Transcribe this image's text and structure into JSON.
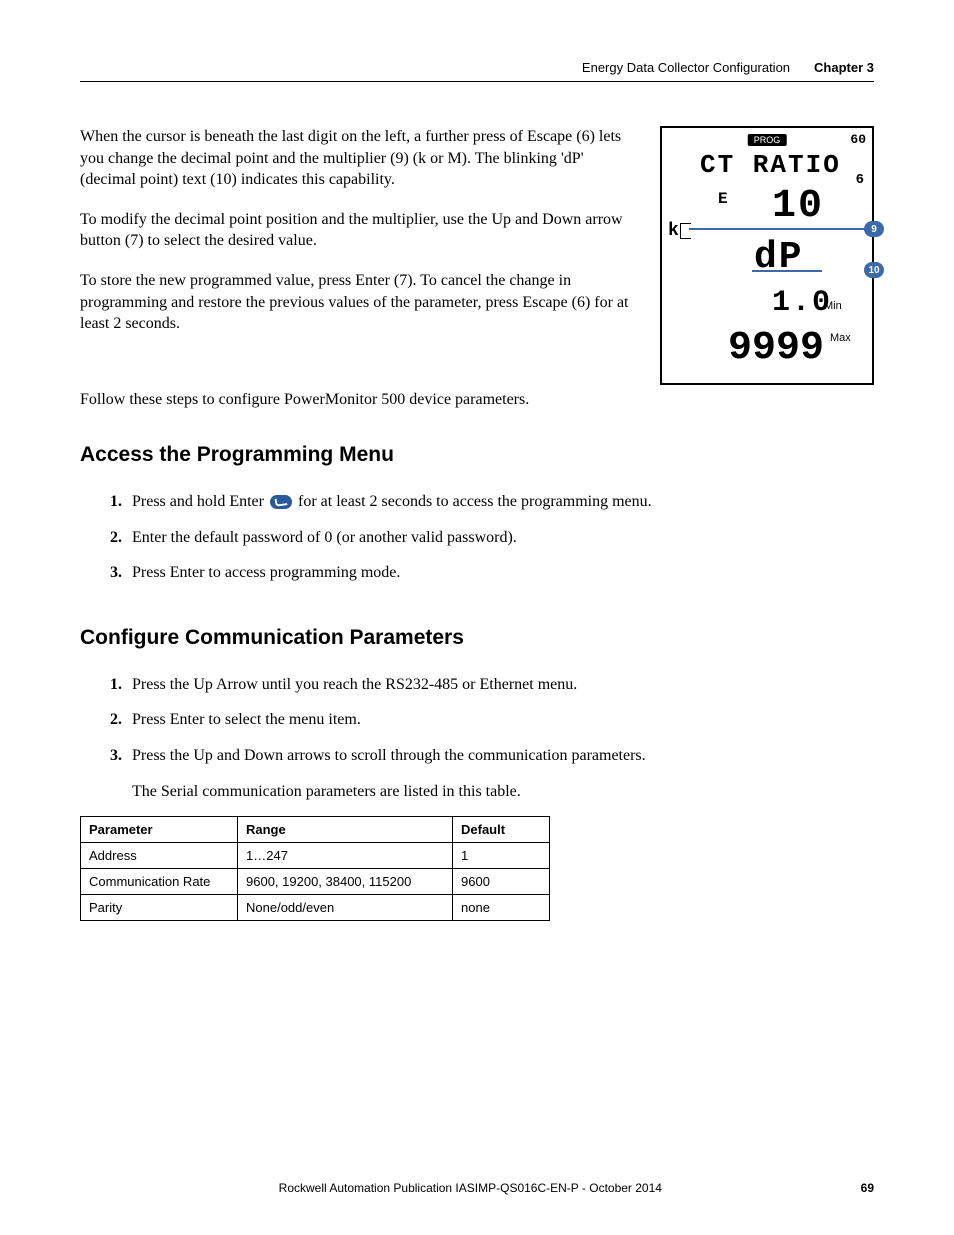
{
  "header": {
    "doc_title": "Energy Data Collector Configuration",
    "chapter": "Chapter 3"
  },
  "intro": {
    "p1": "When the cursor is beneath the last digit on the left, a further press of Escape (6) lets you change the decimal point and the multiplier (9) (k or M). The blinking 'dP' (decimal point) text (10) indicates this capability.",
    "p2": "To modify the decimal point position and the multiplier, use the Up and Down arrow button (7) to select the desired value.",
    "p3": "To store the new programmed value, press Enter (7). To cancel the change in programming and restore the previous values of the parameter, press Escape (6) for at least 2 seconds."
  },
  "lcd": {
    "prog": "PROG",
    "sixty": "60",
    "ct": "CT RATIO",
    "pad": "6",
    "E": "E",
    "ten": "10",
    "k": "k",
    "dp": "dP",
    "ten_min": "1.0",
    "min_label": "Min",
    "nines": "9999",
    "max_label": "Max",
    "callout9": "9",
    "callout10": "10"
  },
  "follow": "Follow these steps to configure PowerMonitor 500 device parameters.",
  "section1": {
    "title": "Access the Programming Menu",
    "step1_a": "Press and hold Enter ",
    "step1_b": " for at least 2 seconds to access the programming menu.",
    "step2": "Enter the default password of 0 (or another valid password).",
    "step3": "Press Enter to access programming mode."
  },
  "section2": {
    "title": "Configure Communication Parameters",
    "step1": "Press the Up Arrow until you reach the RS232-485 or Ethernet menu.",
    "step2": "Press Enter to select the menu item.",
    "step3": "Press the Up and Down arrows to scroll through the communication parameters.",
    "step3_sub": "The Serial communication parameters are listed in this table."
  },
  "table": {
    "headers": {
      "c1": "Parameter",
      "c2": "Range",
      "c3": "Default"
    },
    "rows": {
      "r1": {
        "c1": "Address",
        "c2": "1…247",
        "c3": "1"
      },
      "r2": {
        "c1": "Communication Rate",
        "c2": "9600, 19200, 38400, 115200",
        "c3": "9600"
      },
      "r3": {
        "c1": "Parity",
        "c2": "None/odd/even",
        "c3": "none"
      }
    }
  },
  "footer": {
    "publication": "Rockwell Automation Publication IASIMP-QS016C-EN-P - October 2014",
    "page": "69"
  }
}
